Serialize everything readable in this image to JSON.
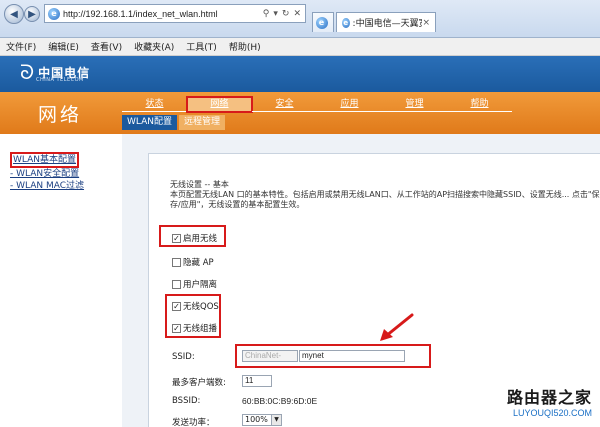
{
  "browser": {
    "url": "http://192.168.1.1/index_net_wlan.html",
    "search_icon": "search-icon",
    "tab_title": ":中国电信—天翼宽带..."
  },
  "menu": [
    "文件(F)",
    "编辑(E)",
    "查看(V)",
    "收藏夹(A)",
    "工具(T)",
    "帮助(H)"
  ],
  "header": {
    "logo_text": "中国电信",
    "logo_sub": "CHINA TELECOM",
    "section_title": "网络"
  },
  "main_nav": [
    "状态",
    "网络",
    "安全",
    "应用",
    "管理",
    "帮助"
  ],
  "sub_nav": [
    "WLAN配置",
    "远程管理"
  ],
  "sidebar": [
    "WLAN基本配置",
    "- WLAN安全配置",
    "- WLAN MAC过滤"
  ],
  "content": {
    "desc_title": "无线设置 -- 基本",
    "desc_body": "本页配置无线LAN 口的基本特性。包括启用或禁用无线LAN口、从工作站的AP扫描搜索中隐藏SSID、设置无线... 点击\"保存/应用\"，无线设置的基本配置生效。",
    "checkboxes": [
      {
        "label": "启用无线",
        "checked": true
      },
      {
        "label": "隐藏 AP",
        "checked": false
      },
      {
        "label": "用户隔离",
        "checked": false
      },
      {
        "label": "无线QOS",
        "checked": true
      },
      {
        "label": "无线组播",
        "checked": true
      }
    ],
    "ssid_label": "SSID:",
    "ssid_prefix": "ChinaNet-",
    "ssid_value": "mynet",
    "max_clients_label": "最多客户端数:",
    "max_clients_value": "11",
    "bssid_label": "BSSID:",
    "bssid_value": "60:BB:0C:B9:6D:0E",
    "power_label": "发送功率：",
    "power_value": "100%"
  },
  "watermark": {
    "title": "路由器之家",
    "url": "LUYOUQI520.COM"
  },
  "colors": {
    "header_blue": "#1b5a9e",
    "orange": "#e07a1a",
    "highlight_red": "#d71a1a"
  }
}
